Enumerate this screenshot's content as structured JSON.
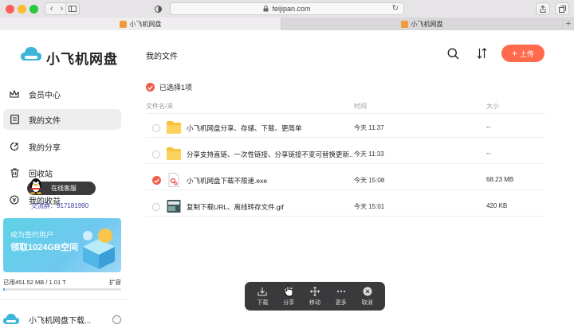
{
  "browser": {
    "url": "feijipan.com",
    "tabs": [
      {
        "label": "小飞机网盘",
        "active": true
      },
      {
        "label": "小飞机网盘",
        "active": false
      }
    ]
  },
  "sidebar": {
    "logo_text": "小飞机网盘",
    "items": [
      {
        "label": "会员中心",
        "icon": "crown-icon"
      },
      {
        "label": "我的文件",
        "icon": "file-icon",
        "active": true
      },
      {
        "label": "我的分享",
        "icon": "share-icon"
      },
      {
        "label": "回收站",
        "icon": "trash-icon"
      },
      {
        "label": "我的收益",
        "icon": "coin-icon"
      }
    ],
    "promo": {
      "line1": "成为签约用户",
      "line2": "领取1024GB空间"
    },
    "storage": {
      "used": "已用451.52 MB / 1.01 T",
      "expand": "扩容",
      "fraction": 0.0004
    },
    "user_name": "小飞机网盘下载...",
    "user_more": "···"
  },
  "qq_float": {
    "label": "在线客服",
    "number": "交流群：917181990"
  },
  "main": {
    "title": "我的文件",
    "upload_label": "上传",
    "selected_info": "已选择1项",
    "columns": {
      "name": "文件名/夹",
      "time": "时间",
      "size": "大小"
    },
    "files": [
      {
        "name": "小飞机网盘分享、存储、下载、更简单",
        "time": "今天 11:37",
        "size": "--",
        "type": "folder",
        "checked": false
      },
      {
        "name": "分享支持直链、一次性链接、分享链接不变可替换更新...",
        "time": "今天 11:33",
        "size": "--",
        "type": "folder",
        "checked": false
      },
      {
        "name": "小飞机网盘下载不限速.exe",
        "time": "今天 15:08",
        "size": "68.23 MB",
        "type": "exe",
        "checked": true
      },
      {
        "name": "复制下载URL、离线转存文件.gif",
        "time": "今天 15:01",
        "size": "420 KB",
        "type": "image",
        "checked": false
      }
    ]
  },
  "action_bar": {
    "items": [
      {
        "label": "下载",
        "icon": "download-icon"
      },
      {
        "label": "分享",
        "icon": "share-icon"
      },
      {
        "label": "移动",
        "icon": "move-icon"
      },
      {
        "label": "更多",
        "icon": "more-icon"
      },
      {
        "label": "取消",
        "icon": "cancel-icon"
      }
    ]
  },
  "colors": {
    "accent": "#ff6b4c",
    "check": "#f05c4a",
    "folder": "#f8c23f",
    "actionbar": "#3a3a3c"
  }
}
